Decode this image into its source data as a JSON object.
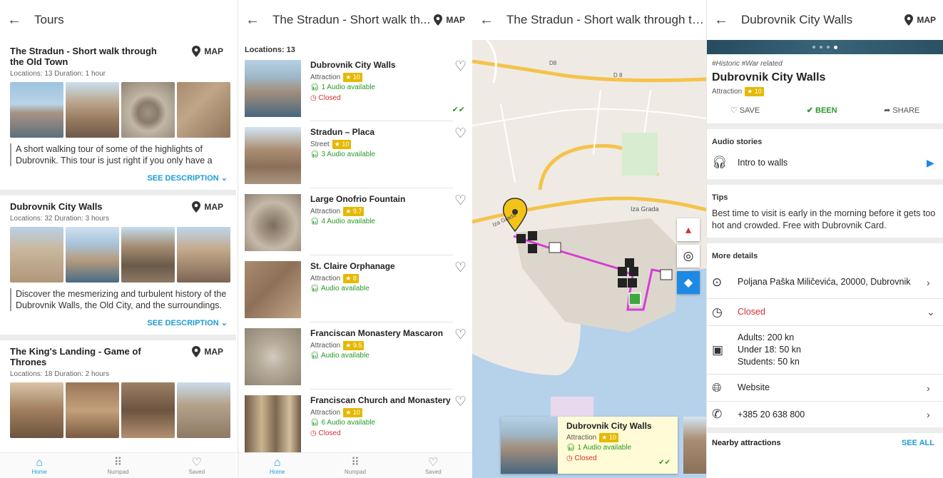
{
  "screen1": {
    "title": "Tours",
    "tours": [
      {
        "title": "The Stradun - Short walk through the Old Town",
        "meta": "Locations: 13  Duration: 1 hour",
        "map": "MAP",
        "desc": "A short walking tour of some of the highlights of Dubrovnik. This tour is just right if you only have a",
        "see": "SEE DESCRIPTION"
      },
      {
        "title": "Dubrovnik City Walls",
        "meta": "Locations: 32  Duration: 3 hours",
        "map": "MAP",
        "desc": "Discover the mesmerizing and turbulent history of the Dubrovnik Walls, the Old City, and the surroundings.",
        "see": "SEE DESCRIPTION"
      },
      {
        "title": "The King's Landing - Game of Thrones",
        "meta": "Locations: 18  Duration: 2 hours",
        "map": "MAP"
      }
    ]
  },
  "nav": {
    "home": "Home",
    "numpad": "Numpad",
    "saved": "Saved"
  },
  "screen2": {
    "title": "The Stradun - Short walk th...",
    "map": "MAP",
    "locations_label": "Locations: 13",
    "items": [
      {
        "name": "Dubrovnik City Walls",
        "cat": "Attraction",
        "rating": "10",
        "audio": "1 Audio available",
        "closed": "Closed"
      },
      {
        "name": "Stradun – Placa",
        "cat": "Street",
        "rating": "10",
        "audio": "3 Audio available"
      },
      {
        "name": "Large Onofrio Fountain",
        "cat": "Attraction",
        "rating": "9.7",
        "audio": "4 Audio available"
      },
      {
        "name": "St. Claire Orphanage",
        "cat": "Attraction",
        "rating": "8",
        "audio": "Audio available"
      },
      {
        "name": "Franciscan Monastery Mascaron",
        "cat": "Attraction",
        "rating": "9.5",
        "audio": "Audio available"
      },
      {
        "name": "Franciscan Church and Monastery",
        "cat": "Attraction",
        "rating": "10",
        "audio": "6 Audio available",
        "closed": "Closed"
      }
    ]
  },
  "screen3": {
    "title": "The Stradun - Short walk through th...",
    "roads": {
      "d8a": "D8",
      "d8b": "D 8",
      "iza_grada": "Iza Grada",
      "iza_grada2": "Iza Grada"
    },
    "card": {
      "name": "Dubrovnik City Walls",
      "cat": "Attraction",
      "rating": "10",
      "audio": "1 Audio available",
      "closed": "Closed"
    }
  },
  "screen4": {
    "title": "Dubrovnik City Walls",
    "map": "MAP",
    "tags": "#Historic #War related",
    "name": "Dubrovnik City Walls",
    "cat": "Attraction",
    "rating": "10",
    "save": "SAVE",
    "been": "BEEN",
    "share": "SHARE",
    "audio_title": "Audio stories",
    "audio_item": "Intro to walls",
    "tips_title": "Tips",
    "tips": "Best time to visit is early in the morning before it gets too hot and crowded. Free with Dubrovnik Card.",
    "more_title": "More details",
    "address": "Poljana Paška Miličevića, 20000, Dubrovnik",
    "hours": "Closed",
    "price1": "Adults: 200 kn",
    "price2": "Under 18: 50 kn",
    "price3": "Students: 50 kn",
    "website": "Website",
    "phone": "+385 20 638 800",
    "nearby": "Nearby attractions",
    "see_all": "SEE ALL"
  },
  "colors": {
    "accent": "#1e9bd7",
    "route": "#d63cd6",
    "green": "#2a9a2a",
    "red": "#d32f2f",
    "star": "#e6b800"
  }
}
